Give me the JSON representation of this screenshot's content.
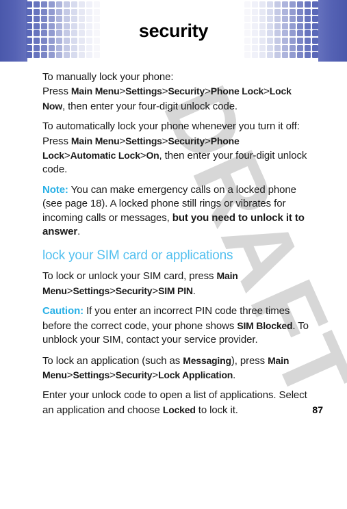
{
  "page": {
    "title": "security",
    "number": "87",
    "watermark": "DRAFT",
    "accent_blue": "#29b0e6",
    "heading_blue": "#54c0ef",
    "band_blue": "#4a58ab"
  },
  "paragraphs": {
    "p1_line1": "To manually lock your phone:",
    "p1_line2_pre": "Press ",
    "p1_menu": [
      "Main Menu",
      "Settings",
      "Security",
      "Phone Lock",
      "Lock Now"
    ],
    "p1_line2_post": ", then enter your four-digit unlock code.",
    "p2_pre": "To automatically lock your phone whenever you turn it off: Press ",
    "p2_menu": [
      "Main Menu",
      "Settings",
      "Security",
      "Phone Lock",
      "Automatic Lock",
      "On"
    ],
    "p2_post": ", then enter your four-digit unlock code.",
    "note_label": "Note:",
    "note_text_1": " You can make emergency calls on a locked phone (see page 18). A locked phone still rings or vibrates for incoming calls or messages, ",
    "note_bold": "but you need to unlock it to answer",
    "note_text_2": ".",
    "section_heading": "lock your SIM card or applications",
    "p3_pre": "To lock or unlock your SIM card, press ",
    "p3_menu": [
      "Main Menu",
      "Settings",
      "Security",
      "SIM PIN"
    ],
    "p3_post": ".",
    "caution_label": "Caution:",
    "caution_text_1": " If you enter an incorrect PIN code three times before the correct code, your phone shows ",
    "caution_menu": "SIM Blocked",
    "caution_text_2": ". To unblock your SIM, contact your service provider.",
    "p4_pre": "To lock an application (such as ",
    "p4_menu_app": "Messaging",
    "p4_mid": "), press ",
    "p4_menu": [
      "Main Menu",
      "Settings",
      "Security",
      "Lock Application"
    ],
    "p4_post": ".",
    "p5_pre": "Enter your unlock code to open a list of applications. Select an application and choose ",
    "p5_menu": "Locked",
    "p5_post": " to lock it."
  },
  "separator": ">"
}
